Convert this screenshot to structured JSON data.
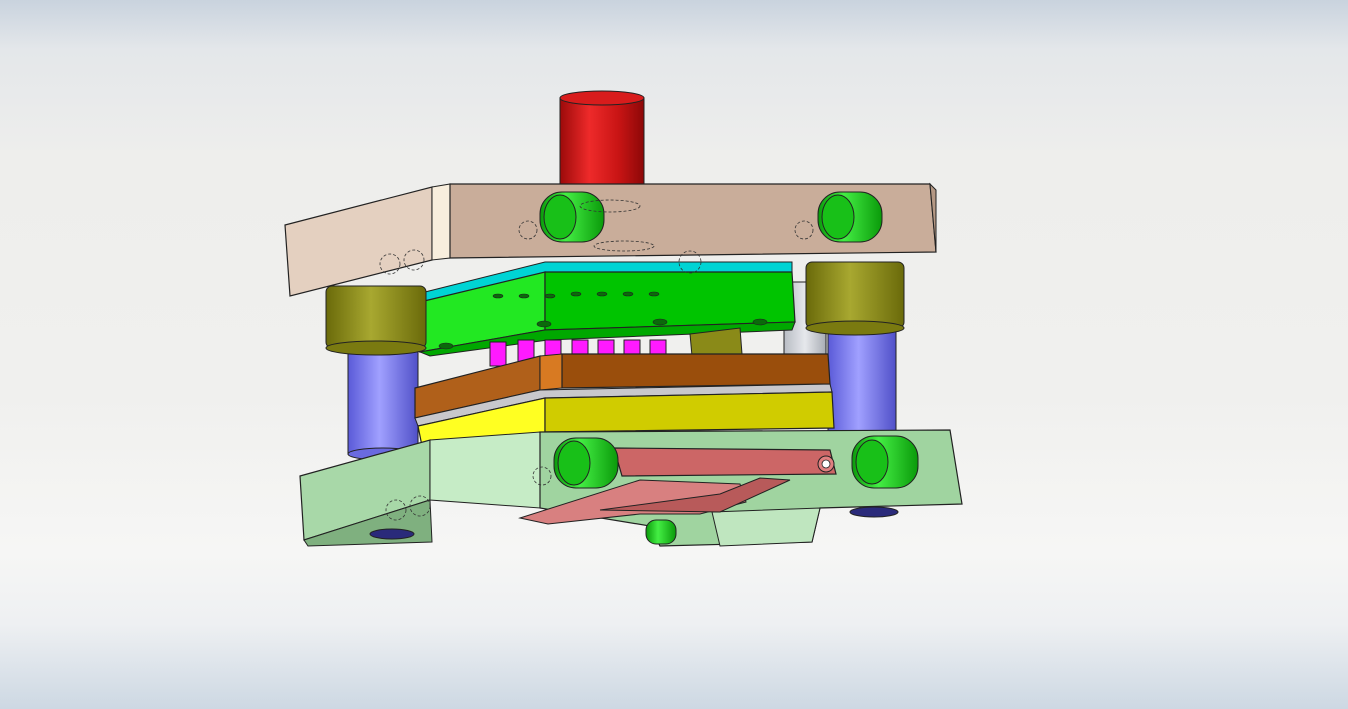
{
  "scene": {
    "kind": "cad-render",
    "subject": "stamping-die-assembly",
    "colors": {
      "top_plate": "#c9ad9a",
      "punch_holder": "#00cc00",
      "backing_plate": "#00d4d4",
      "punches": "#ff00ff",
      "guide_pin": "#7b7bea",
      "guide_bushing": "#8a8a16",
      "stripper_plate": "#9a4e0c",
      "die_plate": "#d0cc00",
      "bottom_plate": "#a8d8a8",
      "shank": "#d11414",
      "screw_caps": "#22cc22",
      "strip": "#cc6666"
    }
  }
}
